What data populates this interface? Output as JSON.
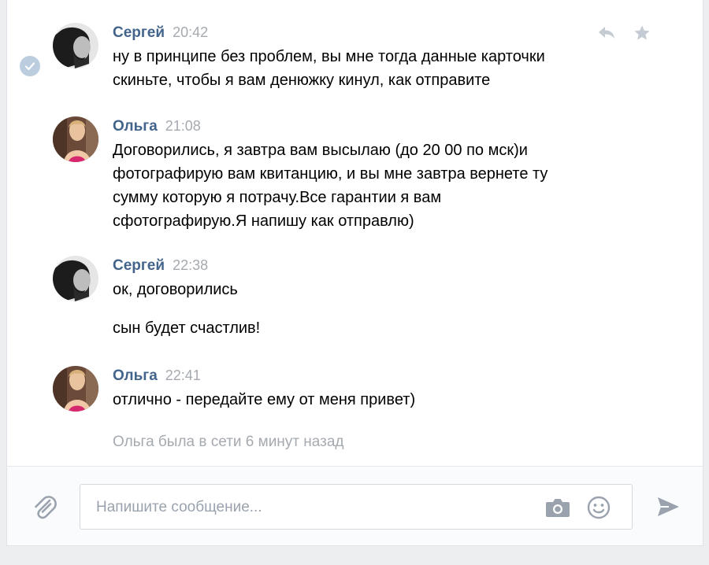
{
  "messages": [
    {
      "author": "Сергей",
      "time": "20:42",
      "avatar": "avatar-sergey",
      "lines": [
        "ну в принципе без проблем, вы мне тогда данные карточки",
        "скиньте, чтобы я вам денюжку кинул, как отправите"
      ]
    },
    {
      "author": "Ольга",
      "time": "21:08",
      "avatar": "avatar-olga",
      "lines": [
        "Договорились, я завтра вам высылаю (до 20 00 по мск)и",
        "фотографирую вам квитанцию, и вы мне завтра вернете ту",
        "сумму которую я потрачу.Все гарантии я вам",
        "сфотографирую.Я напишу как отправлю)"
      ]
    },
    {
      "author": "Сергей",
      "time": "22:38",
      "avatar": "avatar-sergey",
      "lines": [
        "ок, договорились",
        "сын будет счастлив!"
      ]
    },
    {
      "author": "Ольга",
      "time": "22:41",
      "avatar": "avatar-olga",
      "lines": [
        "отлично - передайте ему от меня привет)"
      ]
    }
  ],
  "status": "Ольга была в сети 6 минут назад",
  "composer": {
    "placeholder": "Напишите сообщение..."
  },
  "icons": {
    "read": "check-icon",
    "reply": "reply-icon",
    "favorite": "star-icon",
    "attach": "paperclip-icon",
    "camera": "camera-icon",
    "emoji": "smile-icon",
    "send": "send-icon"
  },
  "colors": {
    "author": "#42648b",
    "time": "#a5aab0",
    "icon": "#99a2ad",
    "read_badge": "#bccde0"
  }
}
